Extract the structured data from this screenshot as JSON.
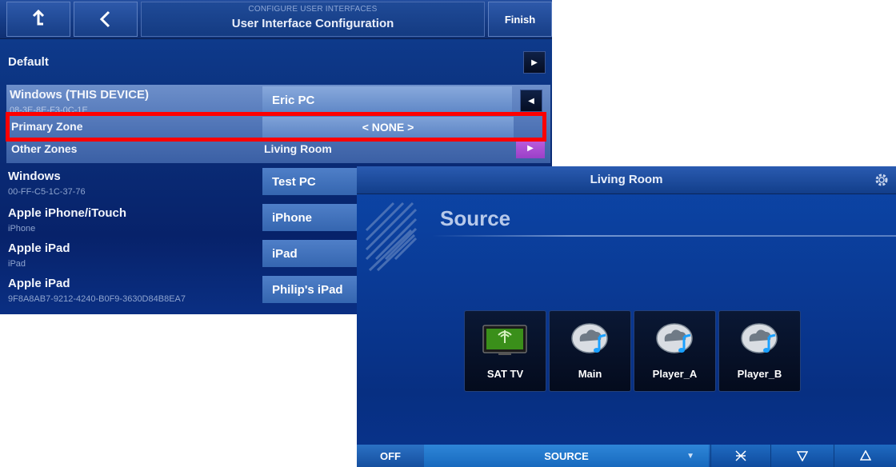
{
  "config": {
    "header": {
      "up_icon": "up-arrow-icon",
      "back_icon": "back-chevron-icon",
      "subtitle": "CONFIGURE USER INTERFACES",
      "title": "User Interface Configuration",
      "finish_label": "Finish"
    },
    "default_label": "Default",
    "selected_device": {
      "label": "Windows (THIS DEVICE)",
      "id": "08-3E-8E-F3-0C-1E",
      "value": "Eric PC"
    },
    "primary_zone": {
      "label": "Primary Zone",
      "value": "< NONE >"
    },
    "other_zones": {
      "label": "Other Zones",
      "value": "Living Room"
    },
    "devices": [
      {
        "label": "Windows",
        "sub": "00-FF-C5-1C-37-76",
        "value": "Test PC"
      },
      {
        "label": "Apple iPhone/iTouch",
        "sub": "iPhone",
        "value": "iPhone"
      },
      {
        "label": "Apple iPad",
        "sub": "iPad",
        "value": "iPad"
      },
      {
        "label": "Apple iPad",
        "sub": "9F8A8AB7-9212-4240-B0F9-3630D84B8EA7",
        "value": "Philip's iPad"
      }
    ]
  },
  "living_room": {
    "title": "Living Room",
    "section_title": "Source",
    "settings_icon": "gear-icon",
    "sources": [
      {
        "label": "SAT TV",
        "icon": "tv-icon"
      },
      {
        "label": "Main",
        "icon": "cloud-music-icon"
      },
      {
        "label": "Player_A",
        "icon": "cloud-music-icon"
      },
      {
        "label": "Player_B",
        "icon": "cloud-music-icon"
      }
    ],
    "bottom": {
      "off_label": "OFF",
      "source_label": "SOURCE",
      "mute_icon": "mute-icon",
      "vol_down_icon": "volume-down-icon",
      "vol_up_icon": "volume-up-icon"
    }
  }
}
